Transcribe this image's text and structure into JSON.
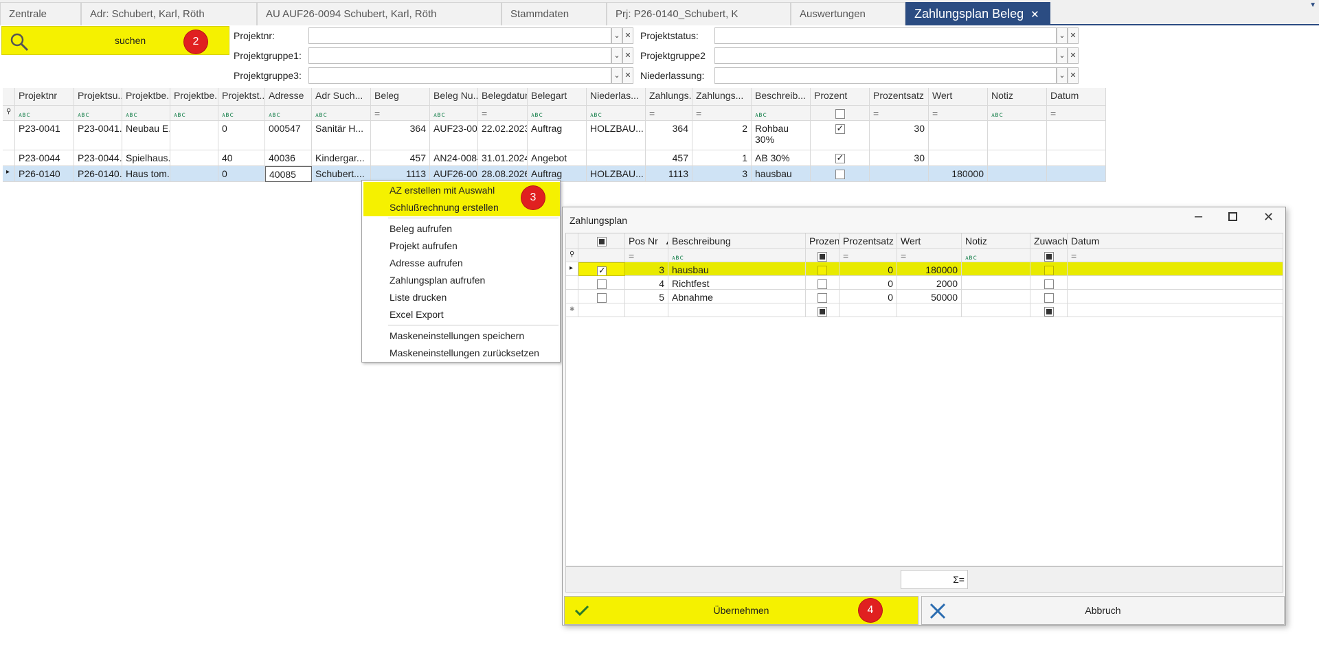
{
  "tabs": [
    {
      "label": "Zentrale"
    },
    {
      "label": "Adr: Schubert, Karl, Röth"
    },
    {
      "label": "AU AUF26-0094 Schubert, Karl, Röth"
    },
    {
      "label": "Stammdaten"
    },
    {
      "label": "Prj: P26-0140_Schubert, K"
    },
    {
      "label": "Auswertungen"
    },
    {
      "label": "Zahlungsplan Beleg"
    }
  ],
  "search": {
    "label": "suchen",
    "badge": "2"
  },
  "filters": {
    "projektnr": "Projektnr:",
    "projektgruppe1": "Projektgruppe1:",
    "projektgruppe3": "Projektgruppe3:",
    "projektstatus": "Projektstatus:",
    "projektgruppe2": "Projektgruppe2",
    "niederlassung": "Niederlassung:"
  },
  "grid": {
    "columns": [
      "Projektnr",
      "Projektsu...",
      "Projektbe...",
      "Projektbe...",
      "Projektst...",
      "Adresse",
      "Adr Such...",
      "Beleg",
      "Beleg Nu...",
      "Belegdatum",
      "Belegart",
      "Niederlas...",
      "Zahlungs...",
      "Zahlungs...",
      "Beschreib...",
      "Prozent",
      "Prozentsatz",
      "Wert",
      "Notiz",
      "Datum"
    ],
    "rows": [
      {
        "projektnr": "P23-0041",
        "projektsu": "P23-0041...",
        "projektbe": "Neubau E...",
        "projektbe2": "",
        "projektst": "0",
        "adresse": "000547",
        "adrsuch": "Sanitär H...",
        "beleg": "364",
        "belegnu": "AUF23-00...",
        "belegdatum": "22.02.2023",
        "belegart": "Auftrag",
        "niederlas": "HOLZBAU...",
        "zahl1": "364",
        "zahl2": "2",
        "beschr1": "Rohbau",
        "beschr2": "30%",
        "prozentsatz": "30",
        "wert": ""
      },
      {
        "projektnr": "P23-0044",
        "projektsu": "P23-0044...",
        "projektbe": "Spielhaus...",
        "projektbe2": "",
        "projektst": "40",
        "adresse": "40036",
        "adrsuch": "Kindergar...",
        "beleg": "457",
        "belegnu": "AN24-0084",
        "belegdatum": "31.01.2024",
        "belegart": "Angebot",
        "niederlas": "",
        "zahl1": "457",
        "zahl2": "1",
        "beschr1": "AB 30%",
        "beschr2": "",
        "prozentsatz": "30",
        "wert": ""
      },
      {
        "projektnr": "P26-0140",
        "projektsu": "P26-0140...",
        "projektbe": "Haus tom...",
        "projektbe2": "",
        "projektst": "0",
        "adresse": "40085",
        "adrsuch": "Schubert....",
        "beleg": "1113",
        "belegnu": "AUF26-00...",
        "belegdatum": "28.08.2026",
        "belegart": "Auftrag",
        "niederlas": "HOLZBAU...",
        "zahl1": "1113",
        "zahl2": "3",
        "beschr1": "hausbau",
        "beschr2": "",
        "prozentsatz": "",
        "wert": "180000"
      }
    ]
  },
  "context_menu": {
    "badge": "3",
    "items": [
      "AZ erstellen mit Auswahl",
      "Schlußrechnung erstellen",
      "Beleg aufrufen",
      "Projekt aufrufen",
      "Adresse aufrufen",
      "Zahlungsplan aufrufen",
      "Liste drucken",
      "Excel Export",
      "Maskeneinstellungen speichern",
      "Maskeneinstellungen zurücksetzen"
    ]
  },
  "dialog": {
    "title": "Zahlungsplan",
    "columns": [
      "Pos Nr",
      "Beschreibung",
      "Prozent",
      "Prozentsatz",
      "Wert",
      "Notiz",
      "Zuwachs",
      "Datum"
    ],
    "rows": [
      {
        "pos": "3",
        "beschreibung": "hausbau",
        "prozentsatz": "0",
        "wert": "180000"
      },
      {
        "pos": "4",
        "beschreibung": "Richtfest",
        "prozentsatz": "0",
        "wert": "2000"
      },
      {
        "pos": "5",
        "beschreibung": "Abnahme",
        "prozentsatz": "0",
        "wert": "50000"
      }
    ],
    "sum_label": "Σ=",
    "ok_label": "Übernehmen",
    "ok_badge": "4",
    "cancel_label": "Abbruch"
  }
}
